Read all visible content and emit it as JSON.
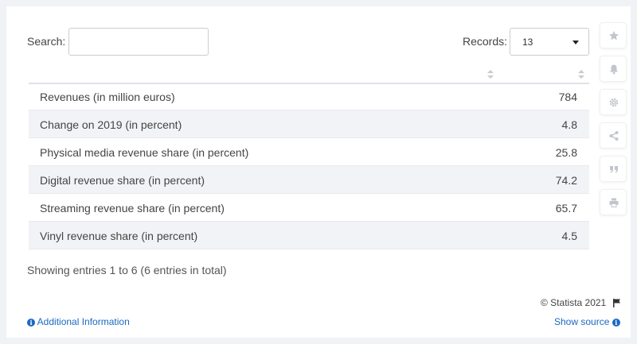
{
  "search": {
    "label": "Search:",
    "value": ""
  },
  "records": {
    "label": "Records:",
    "value": "13"
  },
  "table": {
    "rows": [
      {
        "label": "Revenues (in million euros)",
        "value": "784"
      },
      {
        "label": "Change on 2019 (in percent)",
        "value": "4.8"
      },
      {
        "label": "Physical media revenue share (in percent)",
        "value": "25.8"
      },
      {
        "label": "Digital revenue share (in percent)",
        "value": "74.2"
      },
      {
        "label": "Streaming revenue share (in percent)",
        "value": "65.7"
      },
      {
        "label": "Vinyl revenue share (in percent)",
        "value": "4.5"
      }
    ]
  },
  "footer": {
    "showing": "Showing entries 1 to 6 (6 entries in total)",
    "copyright": "© Statista 2021",
    "additional_info": "Additional Information",
    "show_source": "Show source"
  },
  "sidebar_icons": [
    "star-icon",
    "bell-icon",
    "gear-icon",
    "share-icon",
    "quote-icon",
    "print-icon"
  ],
  "colors": {
    "link": "#1a69c2",
    "icon": "#c1c6cd",
    "stripe": "#f1f3f6"
  }
}
